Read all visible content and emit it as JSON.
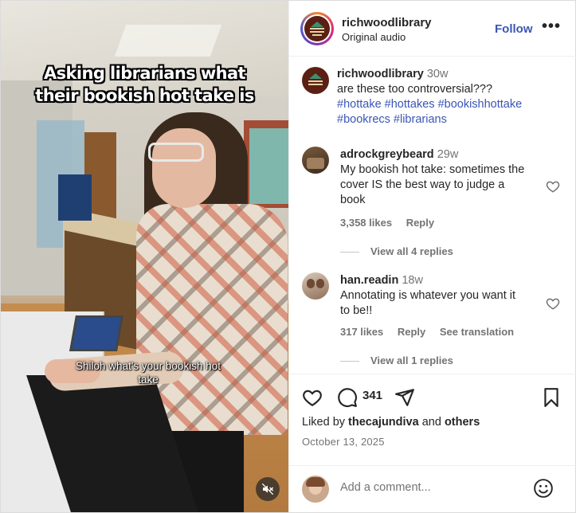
{
  "video": {
    "overlay_title_line1": "Asking librarians what",
    "overlay_title_line2": "their bookish hot take is",
    "caption_line1": "Shiloh what's your bookish hot",
    "caption_line2": "take",
    "mute_icon": "speaker-muted-icon"
  },
  "header": {
    "username": "richwoodlibrary",
    "subtitle": "Original audio",
    "follow_label": "Follow",
    "more_label": "•••"
  },
  "caption": {
    "username": "richwoodlibrary",
    "time": "30w",
    "text": "are these too controversial???",
    "hashtags_line1": "#hottake #hottakes #bookishhottake",
    "hashtags_line2": "#bookrecs #librarians"
  },
  "comments": [
    {
      "username": "adrockgreybeard",
      "time": "29w",
      "text_line1": "My bookish hot take: sometimes the",
      "text_line2": "cover IS the best way to judge a",
      "text_line3": "book",
      "likes": "3,358 likes",
      "reply_label": "Reply",
      "view_replies": "View all 4 replies"
    },
    {
      "username": "han.readin",
      "time": "18w",
      "text_line1": "Annotating is whatever you want it",
      "text_line2": "to be!!",
      "likes": "317 likes",
      "reply_label": "Reply",
      "translate_label": "See translation",
      "view_replies": "View all 1 replies"
    }
  ],
  "actions": {
    "comment_count": "341",
    "liked_prefix": "Liked by ",
    "liked_user": "thecajundiva",
    "liked_and": " and ",
    "liked_others": "others",
    "date": "October 13, 2025"
  },
  "add_comment": {
    "placeholder": "Add a comment..."
  },
  "colors": {
    "link_blue": "#3a55b6",
    "muted_text": "#737373"
  }
}
